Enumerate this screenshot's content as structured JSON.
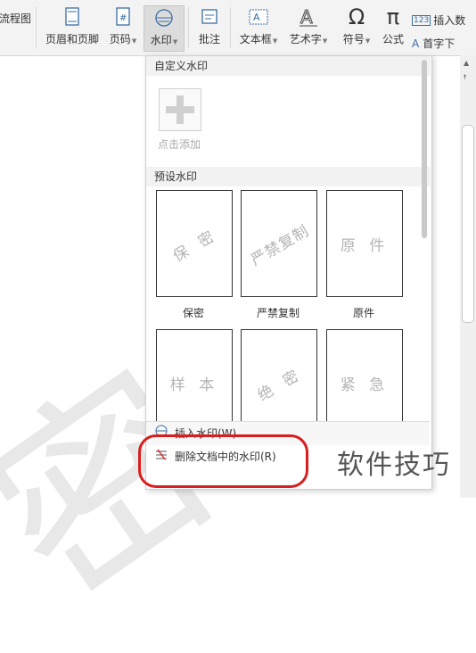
{
  "ribbon": {
    "flowchart": "流程图",
    "header_footer": "页眉和页脚",
    "page_number": "页码",
    "watermark": "水印",
    "comment": "批注",
    "textbox": "文本框",
    "wordart": "艺术字",
    "symbol": "符号",
    "formula": "公式",
    "insert_number": "插入数",
    "drop_cap": "首字下"
  },
  "menu": {
    "custom_header": "自定义水印",
    "add_label": "点击添加",
    "preset_header": "预设水印",
    "presets": [
      {
        "preview": "保 密",
        "label": "保密"
      },
      {
        "preview": "严禁复制",
        "label": "严禁复制"
      },
      {
        "preview": "原 件",
        "label": "原件"
      },
      {
        "preview": "样 本",
        "label": ""
      },
      {
        "preview": "绝 密",
        "label": ""
      },
      {
        "preview": "紧 急",
        "label": ""
      }
    ],
    "insert_watermark": "插入水印(W)...",
    "delete_watermark": "删除文档中的水印(R)"
  },
  "document": {
    "bg_watermark": "密"
  },
  "overlay": {
    "site_text": "软件技巧",
    "highlight_color": "#d81e1e"
  }
}
